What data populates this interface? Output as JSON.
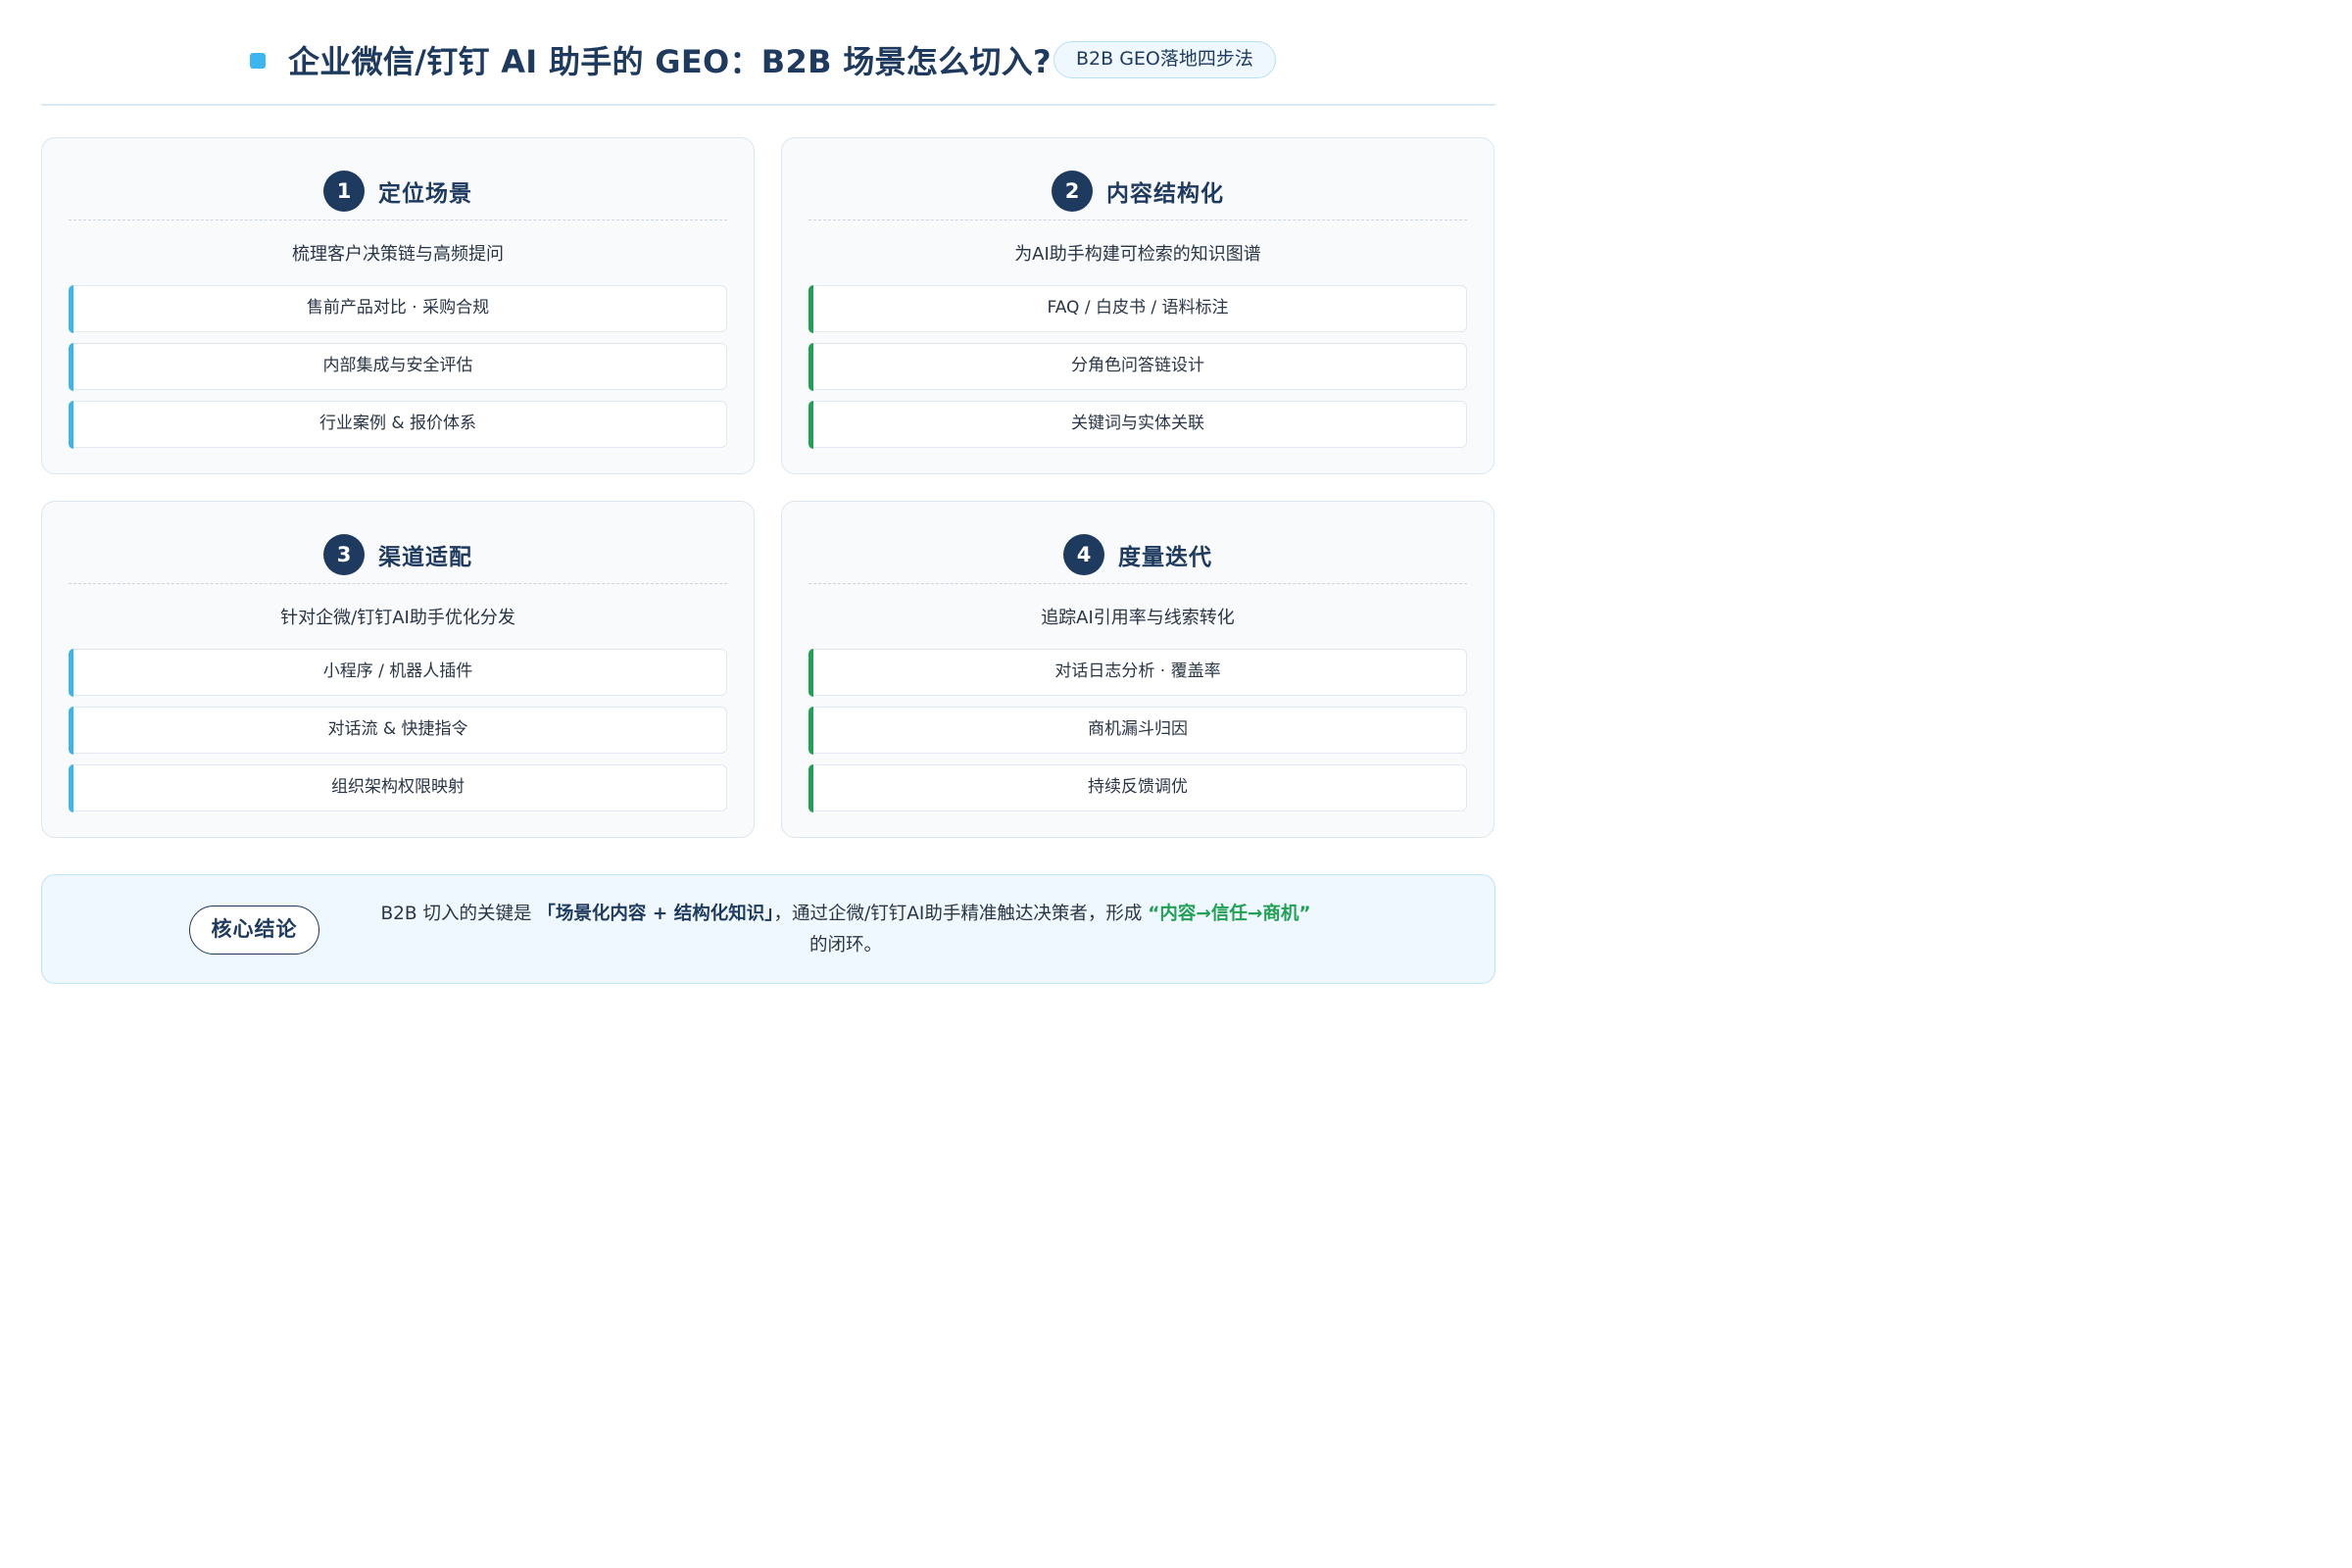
{
  "header": {
    "title": "企业微信/钉钉 AI 助手的 GEO：B2B 场景怎么切入?",
    "tag": "B2B GEO落地四步法"
  },
  "cards": [
    {
      "number": "1",
      "title": "定位场景",
      "subtitle": "梳理客户决策链与高频提问",
      "items": [
        "售前产品对比 · 采购合规",
        "内部集成与安全评估",
        "行业案例 & 报价体系"
      ]
    },
    {
      "number": "2",
      "title": "内容结构化",
      "subtitle": "为AI助手构建可检索的知识图谱",
      "items": [
        "FAQ / 白皮书 / 语料标注",
        "分角色问答链设计",
        "关键词与实体关联"
      ]
    },
    {
      "number": "3",
      "title": "渠道适配",
      "subtitle": "针对企微/钉钉AI助手优化分发",
      "items": [
        "小程序 / 机器人插件",
        "对话流 & 快捷指令",
        "组织架构权限映射"
      ]
    },
    {
      "number": "4",
      "title": "度量迭代",
      "subtitle": "追踪AI引用率与线索转化",
      "items": [
        "对话日志分析 · 覆盖率",
        "商机漏斗归因",
        "持续反馈调优"
      ]
    }
  ],
  "conclusion": {
    "label": "核心结论",
    "text_before": "B2B 切入的关键是 ",
    "highlight_dark": "「场景化内容 + 结构化知识」",
    "text_middle": "，通过企微/钉钉AI助手精准触达决策者，形成 ",
    "highlight_green": "“内容→信任→商机”",
    "text_after": " 的闭环。"
  },
  "colors": {
    "navy": "#1e3a5f",
    "accent_blue": "#3bb6ee",
    "accent_green": "#22a055"
  }
}
